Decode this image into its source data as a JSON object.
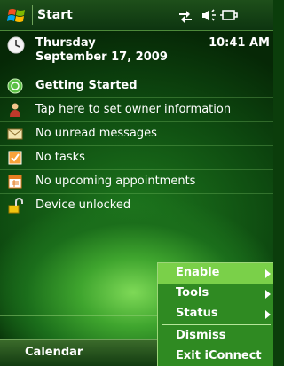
{
  "titlebar": {
    "title": "Start",
    "start_icon": "windows-flag-icon",
    "status_icons": [
      "connectivity-icon",
      "volume-icon",
      "battery-icon"
    ]
  },
  "today": {
    "day": "Thursday",
    "date": "September 17, 2009",
    "time": "10:41 AM",
    "items": [
      {
        "icon": "getting-started-icon",
        "label": "Getting Started",
        "bold": true
      },
      {
        "icon": "owner-icon",
        "label": "Tap here to set owner information"
      },
      {
        "icon": "messages-icon",
        "label": "No unread messages"
      },
      {
        "icon": "tasks-icon",
        "label": "No tasks"
      },
      {
        "icon": "calendar-icon",
        "label": "No upcoming appointments"
      },
      {
        "icon": "unlock-icon",
        "label": "Device unlocked"
      }
    ]
  },
  "softkeys": {
    "left": "Calendar"
  },
  "menu": {
    "items": [
      {
        "label": "Enable",
        "submenu": true,
        "selected": true
      },
      {
        "label": "Tools",
        "submenu": true
      },
      {
        "label": "Status",
        "submenu": true
      },
      {
        "label": "Dismiss",
        "submenu": false
      },
      {
        "label": "Exit iConnect",
        "submenu": false
      }
    ]
  },
  "colors": {
    "menu_bg": "#2f8a22",
    "menu_selected": "#7ad049",
    "titlebar": "#1e4f1a"
  }
}
